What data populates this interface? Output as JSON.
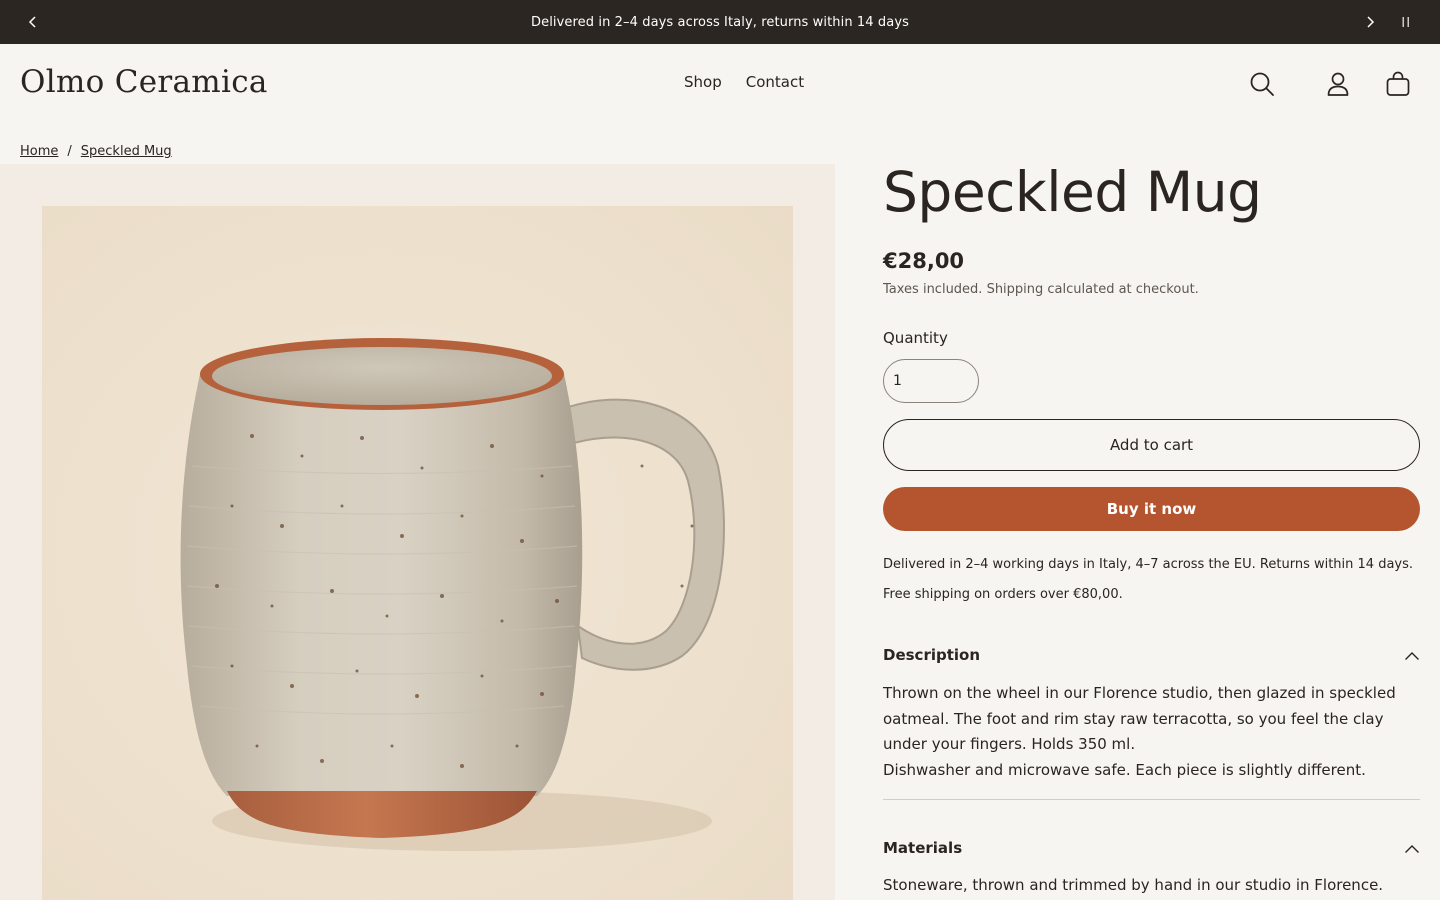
{
  "announcement": {
    "text": "Delivered in 2–4 days across Italy, returns within 14 days",
    "prev_icon": "chevron-left-icon",
    "next_icon": "chevron-right-icon",
    "pause_icon": "pause-icon"
  },
  "header": {
    "logo": "Olmo Ceramica",
    "nav": [
      "Shop",
      "Contact"
    ],
    "icons": [
      "search-icon",
      "account-icon",
      "cart-icon"
    ]
  },
  "breadcrumb": {
    "items": [
      "Home",
      "Speckled Mug"
    ],
    "separator": "/"
  },
  "product": {
    "title": "Speckled Mug",
    "price": "€28,00",
    "tax_note": "Taxes included. Shipping calculated at checkout.",
    "quantity_label": "Quantity",
    "quantity_value": "1",
    "add_to_cart": "Add to cart",
    "buy_now": "Buy it now",
    "shipping_line1": "Delivered in 2–4 working days in Italy, 4–7 across the EU. Returns within 14 days.",
    "shipping_line2": "Free shipping on orders over €80,00.",
    "accordions": [
      {
        "label": "Description",
        "lines": [
          "Thrown on the wheel in our Florence studio, then glazed in speckled",
          "oatmeal. The foot and rim stay raw terracotta, so you feel the clay",
          "under your fingers. Holds 350 ml.",
          "Dishwasher and microwave safe. Each piece is slightly different."
        ]
      },
      {
        "label": "Materials",
        "lines": [
          "Stoneware, thrown and trimmed by hand in our studio in Florence."
        ]
      }
    ]
  },
  "colors": {
    "background": "#f7f5f1",
    "announcement_bg": "#2b2622",
    "accent": "#b5552f",
    "text": "#2a2521"
  }
}
